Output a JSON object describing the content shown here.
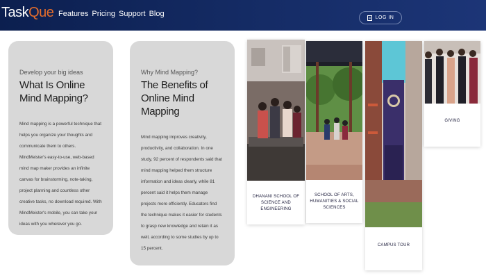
{
  "nav": {
    "logo_prefix": "Task",
    "logo_accent": "Que",
    "links": [
      "Features",
      "Pricing",
      "Support",
      "Blog"
    ],
    "login_label": "LOG IN"
  },
  "card1": {
    "eyebrow": "Develop your big ideas",
    "title": "What Is Online Mind Mapping?",
    "body": "Mind mapping is a powerful technique that helps you organize your thoughts and communicate them to others. MindMeister's easy-to-use, web-based mind map maker provides an infinite canvas for brainstorming, note-taking, project planning and countless other creative tasks, no download required. With MindMeister's mobile, you can take your ideas with you wherever you go."
  },
  "card2": {
    "eyebrow": "Why Mind Mapping?",
    "title": "The Benefits of Online Mind Mapping",
    "body": "Mind mapping improves creativity, productivity, and collaboration. In one study, 92 percent of respondents said that mind mapping helped them structure information and ideas clearly, while 81 percent said it helps them manage projects more efficiently. Educators find the technique makes it easier for students to grasp new knowledge and retain it as well, according to some studies by up to 15 percent."
  },
  "gallery": [
    {
      "caption": "Dhanani School of Science and Engineering"
    },
    {
      "caption": "School of Arts, Humanities & Social Sciences"
    },
    {
      "caption": "Campus Tour"
    },
    {
      "caption": "Giving"
    }
  ],
  "colors": {
    "nav_bg": "#152c66",
    "logo_accent": "#e46d2c",
    "card_bg": "#d8d8d8",
    "caption_text": "#1b1b3a"
  },
  "icons": {
    "login": "login-door-icon"
  }
}
